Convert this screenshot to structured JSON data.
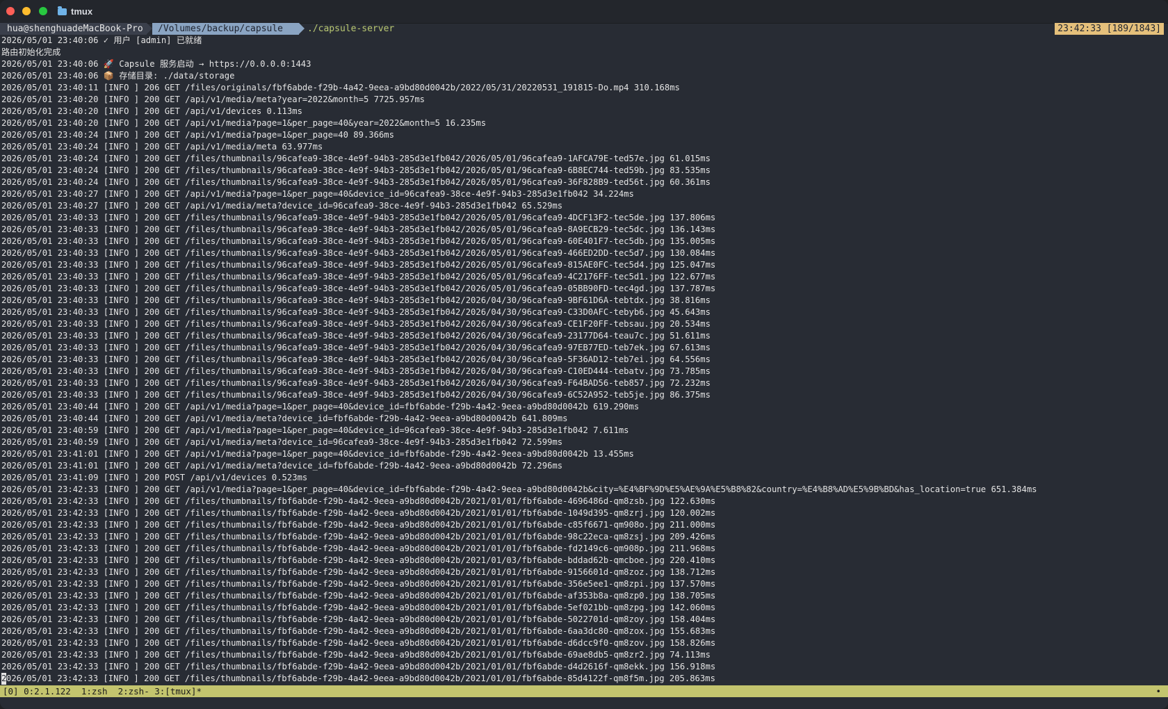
{
  "window": {
    "title": "tmux"
  },
  "prompt": {
    "user_host": "hua@shenghuadeMacBook-Pro",
    "path": "/Volumes/backup/capsule",
    "command": "./capsule-server",
    "clock": "23:42:33 [189/1843]"
  },
  "log_lines": [
    "2026/05/01 23:40:06 ✓ 用户 [admin] 已就绪",
    "路由初始化完成",
    "2026/05/01 23:40:06 🚀 Capsule 服务启动 → https://0.0.0.0:1443",
    "2026/05/01 23:40:06 📦 存储目录: ./data/storage",
    "2026/05/01 23:40:11 [INFO ] 206 GET /files/originals/fbf6abde-f29b-4a42-9eea-a9bd80d0042b/2022/05/31/20220531_191815-Do.mp4 310.168ms",
    "2026/05/01 23:40:20 [INFO ] 200 GET /api/v1/media/meta?year=2022&month=5 7725.957ms",
    "2026/05/01 23:40:20 [INFO ] 200 GET /api/v1/devices 0.113ms",
    "2026/05/01 23:40:20 [INFO ] 200 GET /api/v1/media?page=1&per_page=40&year=2022&month=5 16.235ms",
    "2026/05/01 23:40:24 [INFO ] 200 GET /api/v1/media?page=1&per_page=40 89.366ms",
    "2026/05/01 23:40:24 [INFO ] 200 GET /api/v1/media/meta 63.977ms",
    "2026/05/01 23:40:24 [INFO ] 200 GET /files/thumbnails/96cafea9-38ce-4e9f-94b3-285d3e1fb042/2026/05/01/96cafea9-1AFCA79E-ted57e.jpg 61.015ms",
    "2026/05/01 23:40:24 [INFO ] 200 GET /files/thumbnails/96cafea9-38ce-4e9f-94b3-285d3e1fb042/2026/05/01/96cafea9-6B8EC744-ted59b.jpg 83.535ms",
    "2026/05/01 23:40:24 [INFO ] 200 GET /files/thumbnails/96cafea9-38ce-4e9f-94b3-285d3e1fb042/2026/05/01/96cafea9-36F828B9-ted56t.jpg 60.361ms",
    "2026/05/01 23:40:27 [INFO ] 200 GET /api/v1/media?page=1&per_page=40&device_id=96cafea9-38ce-4e9f-94b3-285d3e1fb042 34.224ms",
    "2026/05/01 23:40:27 [INFO ] 200 GET /api/v1/media/meta?device_id=96cafea9-38ce-4e9f-94b3-285d3e1fb042 65.529ms",
    "2026/05/01 23:40:33 [INFO ] 200 GET /files/thumbnails/96cafea9-38ce-4e9f-94b3-285d3e1fb042/2026/05/01/96cafea9-4DCF13F2-tec5de.jpg 137.806ms",
    "2026/05/01 23:40:33 [INFO ] 200 GET /files/thumbnails/96cafea9-38ce-4e9f-94b3-285d3e1fb042/2026/05/01/96cafea9-8A9ECB29-tec5dc.jpg 136.143ms",
    "2026/05/01 23:40:33 [INFO ] 200 GET /files/thumbnails/96cafea9-38ce-4e9f-94b3-285d3e1fb042/2026/05/01/96cafea9-60E401F7-tec5db.jpg 135.005ms",
    "2026/05/01 23:40:33 [INFO ] 200 GET /files/thumbnails/96cafea9-38ce-4e9f-94b3-285d3e1fb042/2026/05/01/96cafea9-466ED2DD-tec5d7.jpg 130.084ms",
    "2026/05/01 23:40:33 [INFO ] 200 GET /files/thumbnails/96cafea9-38ce-4e9f-94b3-285d3e1fb042/2026/05/01/96cafea9-815AE0FC-tec5d4.jpg 125.047ms",
    "2026/05/01 23:40:33 [INFO ] 200 GET /files/thumbnails/96cafea9-38ce-4e9f-94b3-285d3e1fb042/2026/05/01/96cafea9-4C2176FF-tec5d1.jpg 122.677ms",
    "2026/05/01 23:40:33 [INFO ] 200 GET /files/thumbnails/96cafea9-38ce-4e9f-94b3-285d3e1fb042/2026/05/01/96cafea9-05BB90FD-tec4gd.jpg 137.787ms",
    "2026/05/01 23:40:33 [INFO ] 200 GET /files/thumbnails/96cafea9-38ce-4e9f-94b3-285d3e1fb042/2026/04/30/96cafea9-9BF61D6A-tebtdx.jpg 38.816ms",
    "2026/05/01 23:40:33 [INFO ] 200 GET /files/thumbnails/96cafea9-38ce-4e9f-94b3-285d3e1fb042/2026/04/30/96cafea9-C33D0AFC-tebyb6.jpg 45.643ms",
    "2026/05/01 23:40:33 [INFO ] 200 GET /files/thumbnails/96cafea9-38ce-4e9f-94b3-285d3e1fb042/2026/04/30/96cafea9-CE1F20FF-tebsau.jpg 20.534ms",
    "2026/05/01 23:40:33 [INFO ] 200 GET /files/thumbnails/96cafea9-38ce-4e9f-94b3-285d3e1fb042/2026/04/30/96cafea9-23177D64-teau7c.jpg 51.611ms",
    "2026/05/01 23:40:33 [INFO ] 200 GET /files/thumbnails/96cafea9-38ce-4e9f-94b3-285d3e1fb042/2026/04/30/96cafea9-97EB77ED-teb7ek.jpg 67.613ms",
    "2026/05/01 23:40:33 [INFO ] 200 GET /files/thumbnails/96cafea9-38ce-4e9f-94b3-285d3e1fb042/2026/04/30/96cafea9-5F36AD12-teb7ei.jpg 64.556ms",
    "2026/05/01 23:40:33 [INFO ] 200 GET /files/thumbnails/96cafea9-38ce-4e9f-94b3-285d3e1fb042/2026/04/30/96cafea9-C10ED444-tebatv.jpg 73.785ms",
    "2026/05/01 23:40:33 [INFO ] 200 GET /files/thumbnails/96cafea9-38ce-4e9f-94b3-285d3e1fb042/2026/04/30/96cafea9-F64BAD56-teb857.jpg 72.232ms",
    "2026/05/01 23:40:33 [INFO ] 200 GET /files/thumbnails/96cafea9-38ce-4e9f-94b3-285d3e1fb042/2026/04/30/96cafea9-6C52A952-teb5je.jpg 86.375ms",
    "2026/05/01 23:40:44 [INFO ] 200 GET /api/v1/media?page=1&per_page=40&device_id=fbf6abde-f29b-4a42-9eea-a9bd80d0042b 619.290ms",
    "2026/05/01 23:40:44 [INFO ] 200 GET /api/v1/media/meta?device_id=fbf6abde-f29b-4a42-9eea-a9bd80d0042b 641.809ms",
    "2026/05/01 23:40:59 [INFO ] 200 GET /api/v1/media?page=1&per_page=40&device_id=96cafea9-38ce-4e9f-94b3-285d3e1fb042 7.611ms",
    "2026/05/01 23:40:59 [INFO ] 200 GET /api/v1/media/meta?device_id=96cafea9-38ce-4e9f-94b3-285d3e1fb042 72.599ms",
    "2026/05/01 23:41:01 [INFO ] 200 GET /api/v1/media?page=1&per_page=40&device_id=fbf6abde-f29b-4a42-9eea-a9bd80d0042b 13.455ms",
    "2026/05/01 23:41:01 [INFO ] 200 GET /api/v1/media/meta?device_id=fbf6abde-f29b-4a42-9eea-a9bd80d0042b 72.296ms",
    "2026/05/01 23:41:09 [INFO ] 200 POST /api/v1/devices 0.523ms",
    "2026/05/01 23:42:33 [INFO ] 200 GET /api/v1/media?page=1&per_page=40&device_id=fbf6abde-f29b-4a42-9eea-a9bd80d0042b&city=%E4%BF%9D%E5%AE%9A%E5%B8%82&country=%E4%B8%AD%E5%9B%BD&has_location=true 651.384ms",
    "2026/05/01 23:42:33 [INFO ] 200 GET /files/thumbnails/fbf6abde-f29b-4a42-9eea-a9bd80d0042b/2021/01/01/fbf6abde-4696486d-qm8zsb.jpg 122.630ms",
    "2026/05/01 23:42:33 [INFO ] 200 GET /files/thumbnails/fbf6abde-f29b-4a42-9eea-a9bd80d0042b/2021/01/01/fbf6abde-1049d395-qm8zrj.jpg 120.002ms",
    "2026/05/01 23:42:33 [INFO ] 200 GET /files/thumbnails/fbf6abde-f29b-4a42-9eea-a9bd80d0042b/2021/01/01/fbf6abde-c85f6671-qm908o.jpg 211.000ms",
    "2026/05/01 23:42:33 [INFO ] 200 GET /files/thumbnails/fbf6abde-f29b-4a42-9eea-a9bd80d0042b/2021/01/01/fbf6abde-98c22eca-qm8zsj.jpg 209.426ms",
    "2026/05/01 23:42:33 [INFO ] 200 GET /files/thumbnails/fbf6abde-f29b-4a42-9eea-a9bd80d0042b/2021/01/01/fbf6abde-fd2149c6-qm908p.jpg 211.968ms",
    "2026/05/01 23:42:33 [INFO ] 200 GET /files/thumbnails/fbf6abde-f29b-4a42-9eea-a9bd80d0042b/2021/01/03/fbf6abde-bddad62b-qmcboe.jpg 220.410ms",
    "2026/05/01 23:42:33 [INFO ] 200 GET /files/thumbnails/fbf6abde-f29b-4a42-9eea-a9bd80d0042b/2021/01/01/fbf6abde-9156601d-qm8zoz.jpg 138.712ms",
    "2026/05/01 23:42:33 [INFO ] 200 GET /files/thumbnails/fbf6abde-f29b-4a42-9eea-a9bd80d0042b/2021/01/01/fbf6abde-356e5ee1-qm8zpi.jpg 137.570ms",
    "2026/05/01 23:42:33 [INFO ] 200 GET /files/thumbnails/fbf6abde-f29b-4a42-9eea-a9bd80d0042b/2021/01/01/fbf6abde-af353b8a-qm8zp0.jpg 138.705ms",
    "2026/05/01 23:42:33 [INFO ] 200 GET /files/thumbnails/fbf6abde-f29b-4a42-9eea-a9bd80d0042b/2021/01/01/fbf6abde-5ef021bb-qm8zpg.jpg 142.060ms",
    "2026/05/01 23:42:33 [INFO ] 200 GET /files/thumbnails/fbf6abde-f29b-4a42-9eea-a9bd80d0042b/2021/01/01/fbf6abde-5022701d-qm8zoy.jpg 158.404ms",
    "2026/05/01 23:42:33 [INFO ] 200 GET /files/thumbnails/fbf6abde-f29b-4a42-9eea-a9bd80d0042b/2021/01/01/fbf6abde-6aa3dc80-qm8zox.jpg 155.683ms",
    "2026/05/01 23:42:33 [INFO ] 200 GET /files/thumbnails/fbf6abde-f29b-4a42-9eea-a9bd80d0042b/2021/01/01/fbf6abde-d6dcc9f0-qm8zov.jpg 158.826ms",
    "2026/05/01 23:42:33 [INFO ] 200 GET /files/thumbnails/fbf6abde-f29b-4a42-9eea-a9bd80d0042b/2021/01/01/fbf6abde-69ae8db5-qm8zr2.jpg 74.113ms",
    "2026/05/01 23:42:33 [INFO ] 200 GET /files/thumbnails/fbf6abde-f29b-4a42-9eea-a9bd80d0042b/2021/01/01/fbf6abde-d4d2616f-qm8ekk.jpg 156.918ms"
  ],
  "last_line": {
    "cursor_char": "2",
    "rest": "026/05/01 23:42:33 [INFO ] 200 GET /files/thumbnails/fbf6abde-f29b-4a42-9eea-a9bd80d0042b/2021/01/01/fbf6abde-85d4122f-qm8f5m.jpg 205.863ms"
  },
  "statusbar": {
    "left": "[0] 0:2.1.122  1:zsh  2:zsh- 3:[tmux]*",
    "right": "•"
  },
  "colors": {
    "terminal_bg": "#282c34",
    "status_bg": "#c3c46e",
    "path_segment": "#8aa4c2",
    "clock_bg": "#e5c07b",
    "command_text": "#b9c772"
  }
}
